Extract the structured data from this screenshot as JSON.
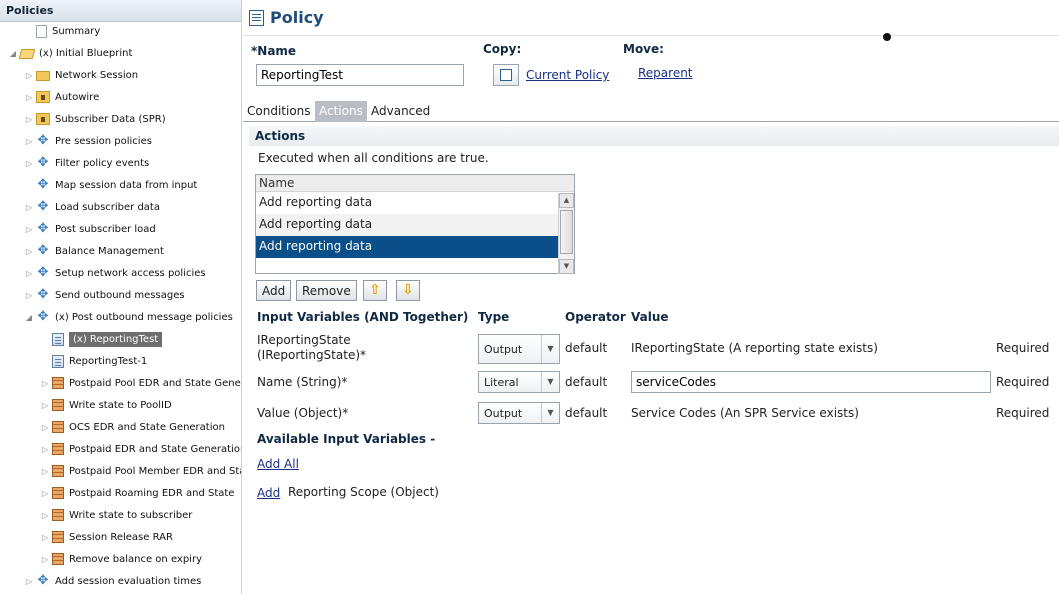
{
  "tree": {
    "header": "Policies",
    "items": [
      {
        "label": "Summary",
        "icon": "page-icon",
        "depth": 1,
        "twisty": ""
      },
      {
        "label": "(x) Initial Blueprint",
        "icon": "folder-open-icon",
        "depth": 0,
        "twisty": "◢"
      },
      {
        "label": "Network Session",
        "icon": "folder-icon",
        "depth": 1,
        "twisty": "▷"
      },
      {
        "label": "Autowire",
        "icon": "locked-folder-icon",
        "depth": 1,
        "twisty": "▷"
      },
      {
        "label": "Subscriber Data (SPR)",
        "icon": "locked-folder-icon",
        "depth": 1,
        "twisty": "▷"
      },
      {
        "label": "Pre session policies",
        "icon": "gear-icon",
        "depth": 1,
        "twisty": "▷"
      },
      {
        "label": "Filter policy events",
        "icon": "gear-icon",
        "depth": 1,
        "twisty": "▷"
      },
      {
        "label": "Map session data from input",
        "icon": "gear-icon",
        "depth": 1,
        "twisty": ""
      },
      {
        "label": "Load subscriber data",
        "icon": "gear-icon",
        "depth": 1,
        "twisty": "▷"
      },
      {
        "label": "Post subscriber load",
        "icon": "gear-icon",
        "depth": 1,
        "twisty": "▷"
      },
      {
        "label": "Balance Management",
        "icon": "gear-icon",
        "depth": 1,
        "twisty": "▷"
      },
      {
        "label": "Setup network access policies",
        "icon": "gear-icon",
        "depth": 1,
        "twisty": "▷"
      },
      {
        "label": "Send outbound messages",
        "icon": "gear-icon",
        "depth": 1,
        "twisty": "▷"
      },
      {
        "label": "(x) Post outbound message policies",
        "icon": "gear-icon",
        "depth": 1,
        "twisty": "◢"
      },
      {
        "label": "(x) ReportingTest",
        "icon": "doc-icon",
        "depth": 2,
        "twisty": "",
        "selected": true
      },
      {
        "label": "ReportingTest-1",
        "icon": "doc-icon",
        "depth": 2,
        "twisty": ""
      },
      {
        "label": "Postpaid Pool EDR and State Generation",
        "icon": "grid-icon",
        "depth": 2,
        "twisty": "▷"
      },
      {
        "label": "Write state to PoolID",
        "icon": "grid-icon",
        "depth": 2,
        "twisty": "▷"
      },
      {
        "label": "OCS EDR and State Generation",
        "icon": "grid-icon",
        "depth": 2,
        "twisty": "▷"
      },
      {
        "label": "Postpaid EDR and State Generation",
        "icon": "grid-icon",
        "depth": 2,
        "twisty": "▷"
      },
      {
        "label": "Postpaid Pool Member EDR and State",
        "icon": "grid-icon",
        "depth": 2,
        "twisty": "▷"
      },
      {
        "label": "Postpaid Roaming EDR and State",
        "icon": "grid-icon",
        "depth": 2,
        "twisty": "▷"
      },
      {
        "label": "Write state to subscriber",
        "icon": "grid-icon",
        "depth": 2,
        "twisty": "▷"
      },
      {
        "label": "Session Release RAR",
        "icon": "grid-icon",
        "depth": 2,
        "twisty": "▷"
      },
      {
        "label": "Remove balance on expiry",
        "icon": "grid-icon",
        "depth": 2,
        "twisty": "▷"
      },
      {
        "label": "Add session evaluation times",
        "icon": "gear-icon",
        "depth": 1,
        "twisty": "▷"
      }
    ]
  },
  "policy": {
    "title": "Policy",
    "name_label": "*Name",
    "name_value": "ReportingTest",
    "copy_label": "Copy:",
    "copy_link": "Current Policy",
    "move_label": "Move:",
    "move_link": "Reparent"
  },
  "tabs": [
    {
      "label": "Conditions",
      "active": false
    },
    {
      "label": "Actions",
      "active": true
    },
    {
      "label": "Advanced",
      "active": false
    }
  ],
  "actions": {
    "header": "Actions",
    "description": "Executed when all conditions are true.",
    "list_header": "Name",
    "items": [
      "Add reporting data",
      "Add reporting data",
      "Add reporting data"
    ],
    "selected_index": 2,
    "add_label": "Add",
    "remove_label": "Remove",
    "move_up_icon": "arrow-up-icon",
    "move_down_icon": "arrow-down-icon"
  },
  "inputs": {
    "headers": {
      "variables": "Input Variables (AND Together)",
      "type": "Type",
      "operator": "Operator",
      "value": "Value"
    },
    "rows": [
      {
        "name_line1": "IReportingState",
        "name_line2": "(IReportingState)*",
        "type": "Output",
        "operator": "default",
        "value": "IReportingState (A reporting state exists)",
        "required": "Required"
      },
      {
        "name_line1": "Name (String)*",
        "name_line2": "",
        "type": "Literal",
        "operator": "default",
        "value": "serviceCodes",
        "required": "Required"
      },
      {
        "name_line1": "Value (Object)*",
        "name_line2": "",
        "type": "Output",
        "operator": "default",
        "value": "Service Codes (An SPR Service exists)",
        "required": "Required"
      }
    ],
    "available_label": "Available Input Variables -",
    "add_all": "Add All",
    "add_link": "Add",
    "scope": "Reporting Scope (Object)"
  },
  "colors": {
    "accent": "#1f4d7a",
    "selected_row": "#0a4f8a",
    "link": "#1b2f88"
  }
}
